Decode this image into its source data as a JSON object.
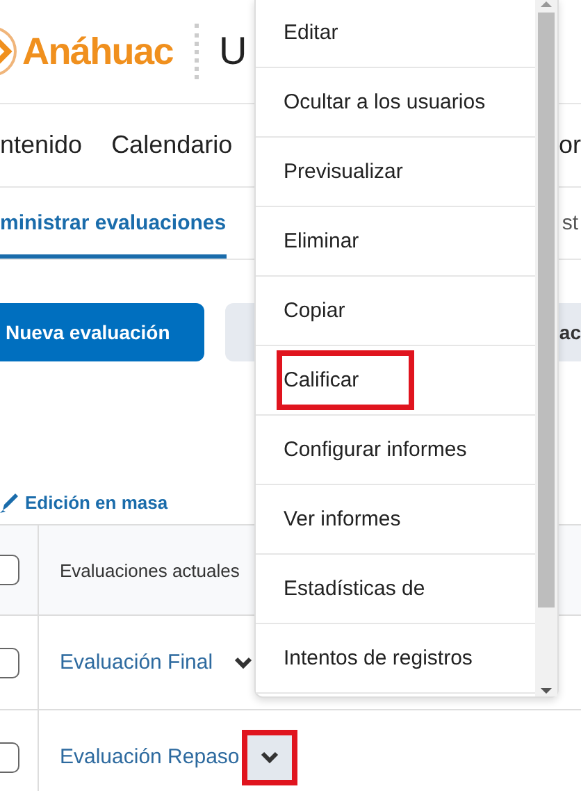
{
  "header": {
    "logo": "Anáhuac",
    "title": "U"
  },
  "nav": [
    {
      "label": "ntenido"
    },
    {
      "label": "Calendario"
    },
    {
      "label": "or"
    }
  ],
  "tabs": [
    {
      "label": "ministrar evaluaciones",
      "selected": true
    },
    {
      "label": "st",
      "selected": false
    }
  ],
  "buttons": [
    {
      "label": "Nueva evaluación",
      "kind": "primary"
    },
    {
      "label": "ac",
      "kind": "secondary"
    }
  ],
  "bulk_edit": "Edición en masa",
  "table": {
    "all_checked": false,
    "columns": [
      "Evaluaciones actuales"
    ],
    "rows": [
      {
        "name": "Evaluación Final",
        "checked": false,
        "annotated": false
      },
      {
        "name": "Evaluación Repaso",
        "checked": false,
        "annotated": true
      }
    ]
  },
  "menu": {
    "items": [
      {
        "label": "Editar",
        "annotated": false
      },
      {
        "label": "Ocultar a los usuarios",
        "annotated": false
      },
      {
        "label": "Previsualizar",
        "annotated": false
      },
      {
        "label": "Eliminar",
        "annotated": false
      },
      {
        "label": "Copiar",
        "annotated": false
      },
      {
        "label": "Calificar",
        "annotated": true
      },
      {
        "label": "Configurar informes",
        "annotated": false
      },
      {
        "label": "Ver informes",
        "annotated": false
      },
      {
        "label": "Estadísticas de",
        "annotated": false
      },
      {
        "label": "Intentos de registros",
        "annotated": false
      }
    ]
  }
}
